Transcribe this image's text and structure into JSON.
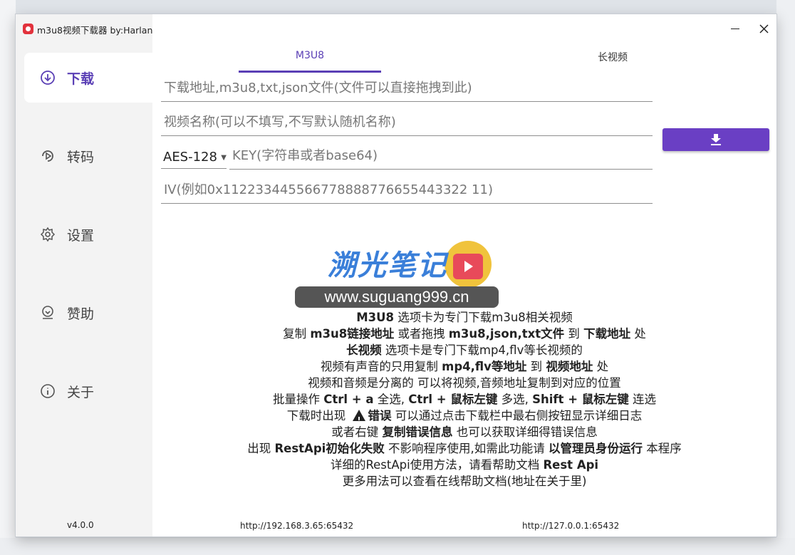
{
  "window": {
    "title": "m3u8视频下载器 by:Harlan"
  },
  "sidebar": {
    "items": [
      {
        "label": "下载",
        "icon": "download-circle-icon",
        "active": true
      },
      {
        "label": "转码",
        "icon": "transcode-icon",
        "active": false
      },
      {
        "label": "设置",
        "icon": "gear-icon",
        "active": false
      },
      {
        "label": "赞助",
        "icon": "sponsor-icon",
        "active": false
      },
      {
        "label": "关于",
        "icon": "info-icon",
        "active": false
      }
    ],
    "version": "v4.0.0"
  },
  "tabs": [
    {
      "label": "M3U8",
      "active": true
    },
    {
      "label": "长视频",
      "active": false
    }
  ],
  "form": {
    "url_placeholder": "下载地址,m3u8,txt,json文件(文件可以直接拖拽到此)",
    "name_placeholder": "视频名称(可以不填写,不写默认随机名称)",
    "method_value": "AES-128",
    "key_placeholder": "KEY(字符串或者base64)",
    "iv_placeholder": "IV(例如0x112233445566778888776655443322 11)"
  },
  "download_button": {
    "icon": "download-icon"
  },
  "watermark": {
    "logo": "溯光笔记",
    "url": "www.suguang999.cn"
  },
  "help": {
    "l1": {
      "a": "M3U8",
      "b": " 选项卡为专门下载m3u8相关视频"
    },
    "l2": {
      "a": "复制 ",
      "b": "m3u8链接地址",
      "c": " 或者拖拽 ",
      "d": "m3u8,json,txt文件",
      "e": " 到 ",
      "f": "下载地址",
      "g": " 处"
    },
    "l3": {
      "a": "长视频",
      "b": " 选项卡是专门下载mp4,flv等长视频的"
    },
    "l4": {
      "a": "视频有声音的只用复制 ",
      "b": "mp4,flv等地址",
      "c": " 到 ",
      "d": "视频地址",
      "e": " 处"
    },
    "l5": {
      "a": "视频和音频是分离的 可以将视频,音频地址复制到对应的位置"
    },
    "l6": {
      "a": "批量操作 ",
      "b": "Ctrl + a",
      "c": " 全选, ",
      "d": "Ctrl + 鼠标左键",
      "e": " 多选, ",
      "f": "Shift + 鼠标左键",
      "g": " 连选"
    },
    "l7": {
      "a": "下载时出现 ",
      "b": "错误",
      "c": " 可以通过点击下载栏中最右侧按钮显示详细日志"
    },
    "l8": {
      "a": "或者右键 ",
      "b": "复制错误信息",
      "c": " 也可以获取详细得错误信息"
    },
    "l9": {
      "a": "出现 ",
      "b": "RestApi初始化失败",
      "c": " 不影响程序使用,如需此功能请 ",
      "d": "以管理员身份运行",
      "e": " 本程序"
    },
    "l10": {
      "a": "详细的RestApi使用方法，请看帮助文档 ",
      "b": "Rest Api"
    },
    "l11": {
      "a": "更多用法可以查看在线帮助文档(地址在关于里)"
    }
  },
  "status": {
    "left": "http://192.168.3.65:65432",
    "right": "http://127.0.0.1:65432"
  },
  "colors": {
    "accent": "#5a3fb5",
    "button": "#6a3fc4"
  }
}
